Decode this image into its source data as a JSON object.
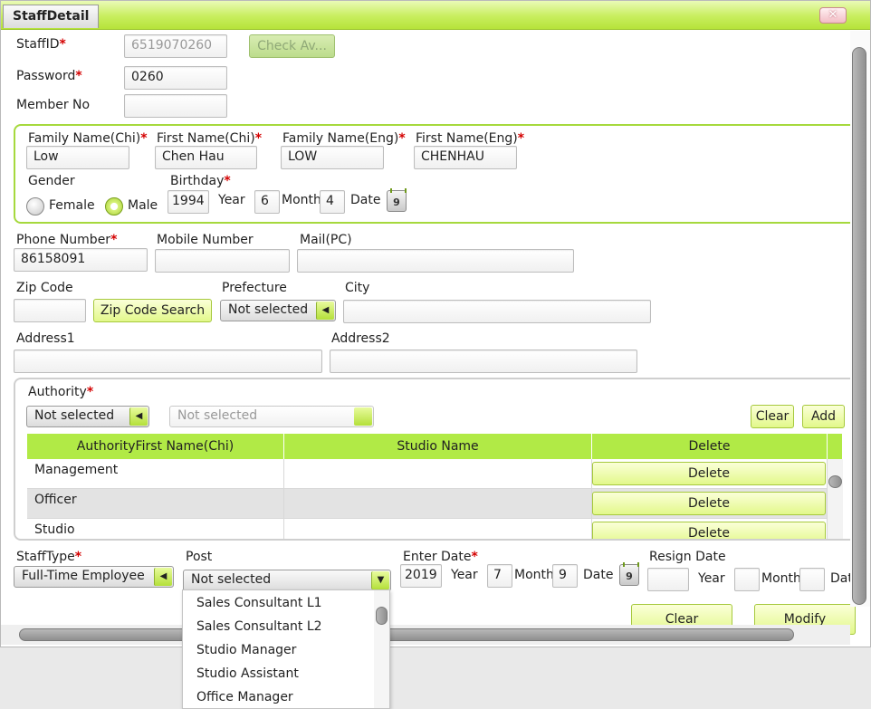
{
  "window": {
    "title": "StaffDetail",
    "close_glyph": "✕"
  },
  "staff": {
    "staffid_label": "StaffID",
    "staffid_value": "6519070260",
    "check_button": "Check Av...",
    "password_label": "Password",
    "password_value": "0260",
    "member_label": "Member No",
    "member_value": ""
  },
  "name_group": {
    "family_chi_label": "Family Name(Chi)",
    "family_chi_value": "Low",
    "first_chi_label": "First Name(Chi)",
    "first_chi_value": "Chen Hau",
    "family_eng_label": "Family Name(Eng)",
    "family_eng_value": "LOW",
    "first_eng_label": "First Name(Eng)",
    "first_eng_value": "CHENHAU",
    "gender_label": "Gender",
    "female_label": "Female",
    "male_label": "Male",
    "gender_selected": "Male",
    "birthday_label": "Birthday",
    "year_value": "1994",
    "year_label": "Year",
    "month_value": "6",
    "month_label": "Month",
    "date_value": "4",
    "date_label": "Date",
    "calendar_glyph": "9"
  },
  "contact": {
    "phone_label": "Phone Number",
    "phone_value": "86158091",
    "mobile_label": "Mobile Number",
    "mobile_value": "",
    "mail_label": "Mail(PC)",
    "mail_value": "",
    "zip_label": "Zip Code",
    "zip_value": "",
    "zip_search": "Zip Code Search",
    "prefecture_label": "Prefecture",
    "prefecture_value": "Not selected",
    "city_label": "City",
    "city_value": "",
    "address1_label": "Address1",
    "address1_value": "",
    "address2_label": "Address2",
    "address2_value": ""
  },
  "authority": {
    "label": "Authority",
    "select_value": "Not selected",
    "second_select": "Not selected",
    "clear": "Clear",
    "add": "Add",
    "columns": [
      "AuthorityFirst Name(Chi)",
      "Studio Name",
      "Delete"
    ],
    "rows": [
      {
        "name": "Management",
        "studio": "",
        "delete": "Delete"
      },
      {
        "name": "Officer",
        "studio": "",
        "delete": "Delete"
      },
      {
        "name": "Studio",
        "studio": "",
        "delete": "Delete"
      }
    ]
  },
  "employment": {
    "stafftype_label": "StaffType",
    "stafftype_value": "Full-Time Employee",
    "post_label": "Post",
    "post_value": "Not selected",
    "enter_label": "Enter Date",
    "enter_year": "2019",
    "enter_month": "7",
    "enter_date": "9",
    "resign_label": "Resign Date",
    "resign_year": "",
    "resign_month": "",
    "resign_date": "",
    "year_label": "Year",
    "month_label": "Month",
    "date_label": "Date",
    "date_label_cut": "Dat",
    "clear": "Clear",
    "modify": "Modify"
  },
  "post_options": [
    "Sales Consultant L1",
    "Sales Consultant L2",
    "Studio Manager",
    "Studio Assistant",
    "Office Manager"
  ],
  "colors": {
    "accent": "#b1ea46",
    "required": "#d40000"
  }
}
